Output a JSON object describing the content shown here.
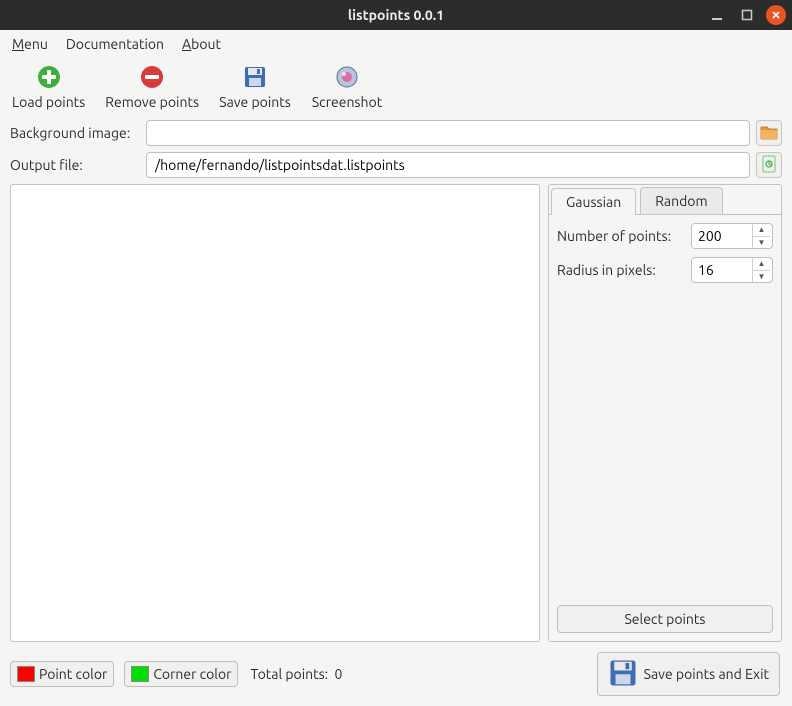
{
  "window": {
    "title": "listpoints 0.0.1"
  },
  "menubar": {
    "items": [
      "Menu",
      "Documentation",
      "About"
    ]
  },
  "toolbar": {
    "load": "Load points",
    "remove": "Remove points",
    "save": "Save points",
    "screenshot": "Screenshot"
  },
  "form": {
    "bg_label": "Background image:",
    "bg_value": "",
    "out_label": "Output file:",
    "out_value": "/home/fernando/listpointsdat.listpoints"
  },
  "tabs": {
    "gaussian": "Gaussian",
    "random": "Random"
  },
  "params": {
    "npoints_label": "Number of points:",
    "npoints_value": "200",
    "radius_label": "Radius in pixels:",
    "radius_value": "16"
  },
  "select_points_label": "Select points",
  "footer": {
    "point_color_label": "Point color",
    "corner_color_label": "Corner color",
    "total_label": "Total points:",
    "total_value": "0",
    "save_exit_label": "Save points and Exit"
  },
  "colors": {
    "point": "#ff0000",
    "corner": "#00dd00",
    "accent": "#e95420"
  },
  "icons": {
    "add": "plus-circle",
    "remove": "minus-circle",
    "save": "floppy",
    "screenshot": "lens",
    "folder": "folder",
    "doc": "document"
  }
}
